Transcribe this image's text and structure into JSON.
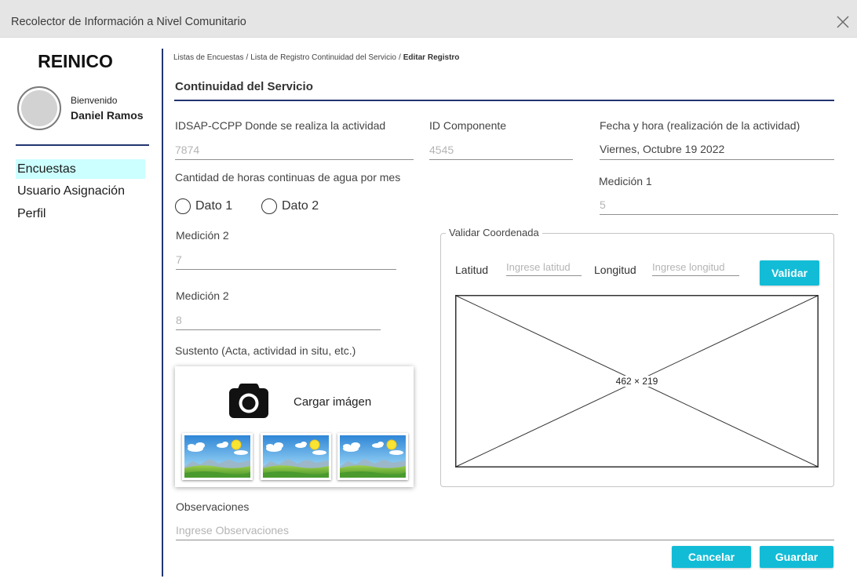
{
  "window": {
    "title": "Recolector de Información a Nivel Comunitario"
  },
  "sidebar": {
    "brand": "REINICO",
    "welcome": "Bienvenido",
    "user_name": "Daniel Ramos",
    "items": [
      {
        "label": "Encuestas",
        "active": true
      },
      {
        "label": "Usuario Asignación",
        "active": false
      },
      {
        "label": "Perfil",
        "active": false
      }
    ]
  },
  "breadcrumb": {
    "items": [
      "Listas de Encuestas",
      "Lista de Registro Continuidad del Servicio",
      "Editar Registro"
    ],
    "separator": "/"
  },
  "page_title": "Continuidad del Servicio",
  "form": {
    "idsap": {
      "label": "IDSAP-CCPP Donde se realiza la actividad",
      "placeholder": "7874"
    },
    "id_componente": {
      "label": "ID Componente",
      "placeholder": "4545"
    },
    "fecha": {
      "label": "Fecha y hora (realización de la actividad)",
      "value": "Viernes, Octubre 19 2022"
    },
    "horas": {
      "label": "Cantidad de horas continuas de agua por mes",
      "options": [
        "Dato 1",
        "Dato 2"
      ],
      "selected": null
    },
    "medicion1": {
      "label": "Medición 1",
      "placeholder": "5"
    },
    "medicion2_a": {
      "label": "Medición 2",
      "placeholder": "7"
    },
    "medicion2_b": {
      "label": "Medición 2",
      "placeholder": "8"
    },
    "sustento": {
      "label": "Sustento (Acta, actividad in situ, etc.)",
      "upload_label": "Cargar imágen",
      "thumbnails": [
        "landscape-image-icon",
        "landscape-image-icon",
        "landscape-image-icon"
      ]
    },
    "coordenada": {
      "legend": "Validar Coordenada",
      "latitude_label": "Latitud",
      "latitude_placeholder": "Ingrese latitud",
      "longitude_label": "Longitud",
      "longitude_placeholder": "Ingrese longitud",
      "validate_label": "Validar",
      "map_placeholder_label": "462 × 219"
    },
    "observaciones": {
      "label": "Observaciones",
      "placeholder": "Ingrese Observaciones"
    }
  },
  "actions": {
    "cancel_label": "Cancelar",
    "save_label": "Guardar"
  },
  "icons": {
    "close": "close-icon",
    "camera": "camera-icon",
    "thumbnail": "landscape-image-icon",
    "avatar": "avatar-placeholder"
  },
  "colors": {
    "accent": "#12bcd6",
    "navy": "#22356f",
    "active_item_bg": "#ccffff",
    "title_bar": "#e5e5e5"
  }
}
